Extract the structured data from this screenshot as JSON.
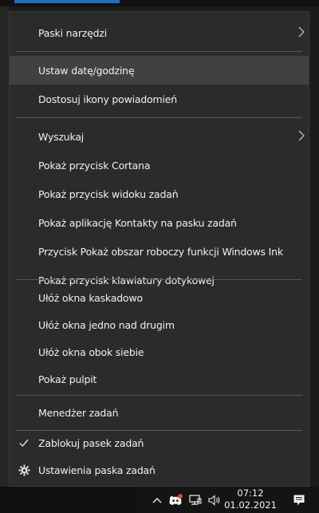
{
  "menu": {
    "items": [
      {
        "label": "Paski narzędzi",
        "submenu": true
      },
      {
        "label": "Ustaw datę/godzinę"
      },
      {
        "label": "Dostosuj ikony powiadomień"
      },
      {
        "label": "Wyszukaj",
        "submenu": true
      },
      {
        "label": "Pokaż przycisk Cortana"
      },
      {
        "label": "Pokaż przycisk widoku zadań"
      },
      {
        "label": "Pokaż aplikację Kontakty na pasku zadań"
      },
      {
        "label": "Przycisk Pokaż obszar roboczy funkcji Windows Ink"
      },
      {
        "label": "Pokaż przycisk klawiatury dotykowej"
      },
      {
        "label": "Ułóż okna kaskadowo"
      },
      {
        "label": "Ułóż okna jedno nad drugim"
      },
      {
        "label": "Ułóż okna obok siebie"
      },
      {
        "label": "Pokaż pulpit"
      },
      {
        "label": "Menedżer zadań"
      },
      {
        "label": "Zablokuj pasek zadań",
        "checked": true
      },
      {
        "label": "Ustawienia paska zadań",
        "icon": "gear-icon"
      }
    ],
    "hovered_index": 1
  },
  "taskbar": {
    "time": "07:12",
    "date": "01.02.2021",
    "tray_icons": [
      "chevron-up-icon",
      "discord-icon",
      "network-icon",
      "volume-icon",
      "notification-icon"
    ]
  },
  "colors": {
    "menu_bg": "#2b2b2b",
    "hover_bg": "#414141",
    "separator": "#555555",
    "discord_badge": "#e8412f"
  }
}
